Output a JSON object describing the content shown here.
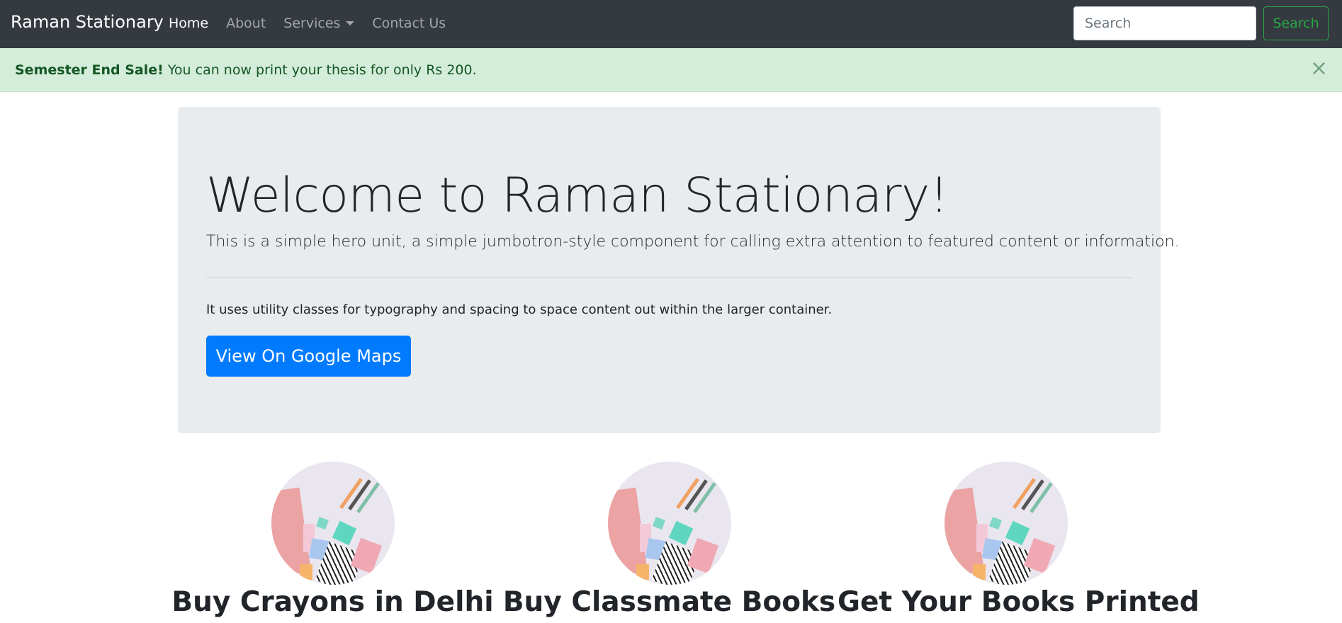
{
  "navbar": {
    "brand": "Raman Stationary",
    "links": [
      {
        "label": "Home",
        "active": true
      },
      {
        "label": "About",
        "active": false
      },
      {
        "label": "Services",
        "active": false,
        "dropdown": true
      },
      {
        "label": "Contact Us",
        "active": false
      }
    ],
    "search_placeholder": "Search",
    "search_button": "Search"
  },
  "alert": {
    "strong": "Semester End Sale!",
    "message": " You can now print your thesis for only Rs 200.",
    "close_symbol": "×"
  },
  "jumbotron": {
    "title": "Welcome to Raman Stationary!",
    "lead": "This is a simple hero unit, a simple jumbotron-style component for calling extra attention to featured content or information.",
    "text": "It uses utility classes for typography and spacing to space content out within the larger container.",
    "button": "View On Google Maps"
  },
  "features": [
    {
      "title": "Buy Crayons in Delhi"
    },
    {
      "title": "Buy Classmate Books"
    },
    {
      "title": "Get Your Books Printed"
    }
  ],
  "colors": {
    "navbar_bg": "#343a40",
    "alert_bg": "#d4edda",
    "jumbotron_bg": "#e9ecef",
    "primary": "#007bff",
    "success": "#28a745"
  }
}
